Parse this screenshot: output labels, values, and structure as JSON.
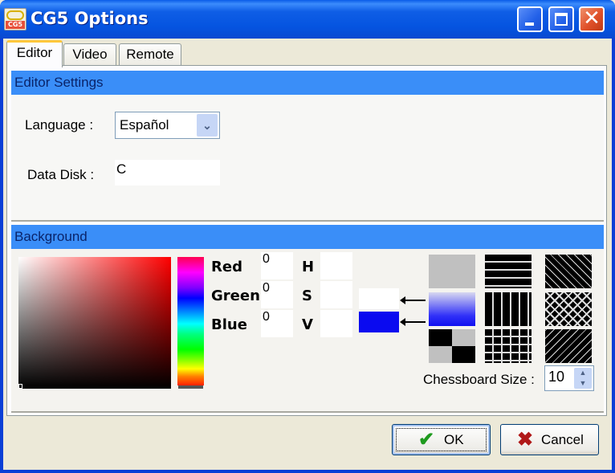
{
  "window": {
    "title": "CG5 Options",
    "app_icon_text": "CG5",
    "controls": {
      "minimize": "minimize-icon",
      "maximize": "maximize-icon",
      "close": "close-icon",
      "close_glyph": "✕"
    }
  },
  "tabs": [
    {
      "label": "Editor",
      "active": true
    },
    {
      "label": "Video",
      "active": false
    },
    {
      "label": "Remote",
      "active": false
    }
  ],
  "editor_settings": {
    "header": "Editor Settings",
    "language_label": "Language :",
    "language_value": "Español",
    "dropdown_glyph": "⌄",
    "data_disk_label": "Data Disk :",
    "data_disk_value": "C"
  },
  "background": {
    "header": "Background",
    "channels": [
      {
        "label": "Red",
        "value": "0"
      },
      {
        "label": "Green",
        "value": "0"
      },
      {
        "label": "Blue",
        "value": "0"
      }
    ],
    "hsv": [
      {
        "label": "H",
        "value": ""
      },
      {
        "label": "S",
        "value": ""
      },
      {
        "label": "V",
        "value": ""
      }
    ],
    "foreground_color": "#ffffff",
    "background_color": "#0a0af0",
    "patterns": [
      "solid-gray",
      "gradient-blue",
      "chessboard",
      "horizontal-lines",
      "vertical-lines",
      "grid",
      "diagonal-lines-down",
      "crosshatch",
      "diagonal-lines-up"
    ],
    "chessboard_label": "Chessboard Size :",
    "chessboard_size": "10",
    "spin_up": "▲",
    "spin_down": "▼"
  },
  "buttons": {
    "ok_label": "OK",
    "ok_icon": "✔",
    "cancel_label": "Cancel",
    "cancel_icon": "✖"
  }
}
